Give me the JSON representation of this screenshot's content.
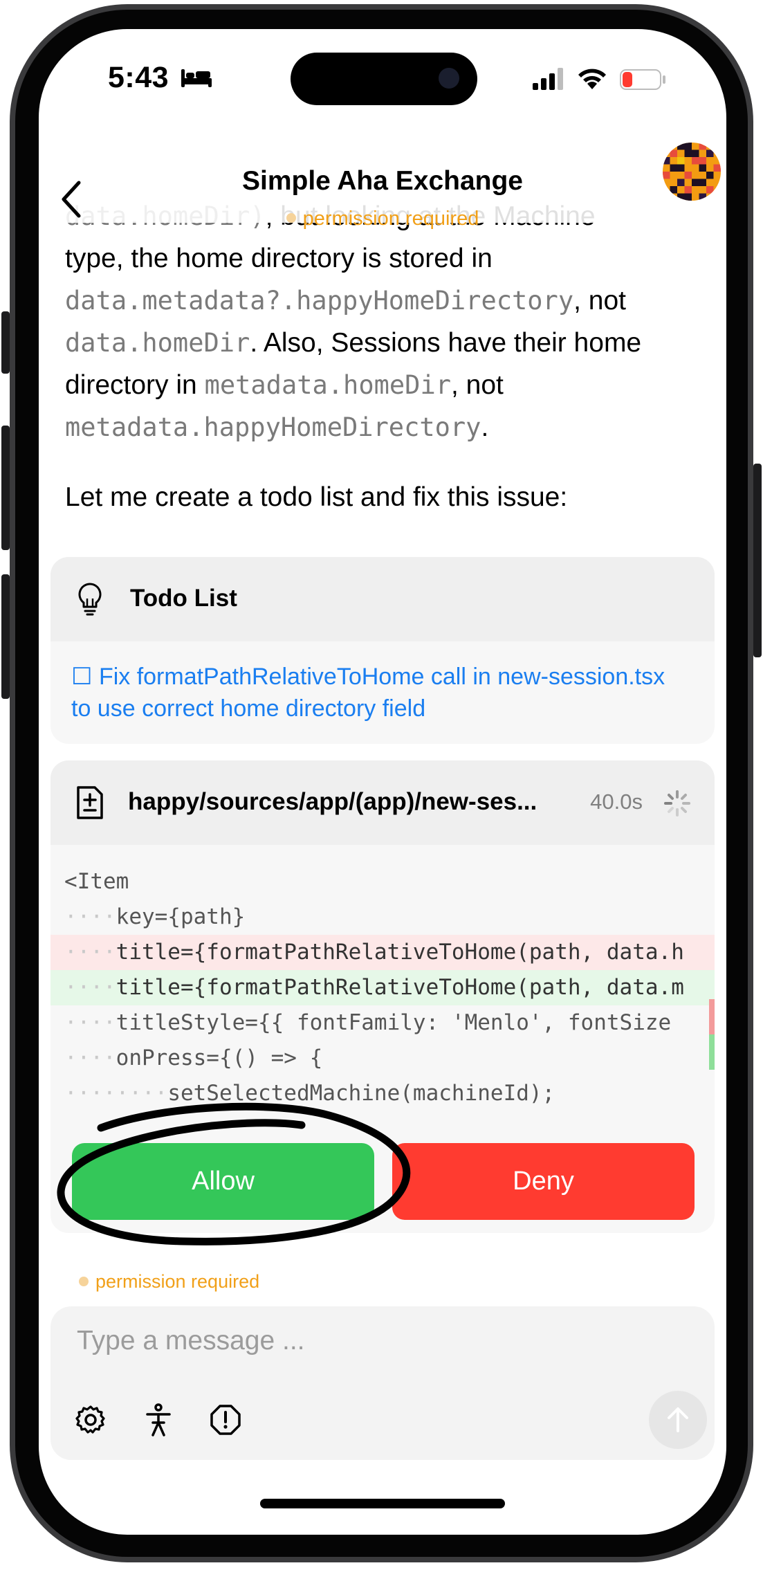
{
  "status_bar": {
    "time": "5:43",
    "battery": "13"
  },
  "header": {
    "title": "Simple Aha Exchange",
    "subtitle": "permission required"
  },
  "message": {
    "p1_line1_code": "data.homeDir)",
    "p1_line1_text": ", but looking at the Machine",
    "p1_line2": "type, the home directory is stored in",
    "p1_line3_code": "data.metadata?.happyHomeDirectory",
    "p1_line3_text": ", not",
    "p1_line4_code": "data.homeDir",
    "p1_line4_text": ". Also, Sessions have their home",
    "p1_line5_text": "directory in ",
    "p1_line5_code": "metadata.homeDir",
    "p1_line5_text2": ", not",
    "p1_line6_code": "metadata.happyHomeDirectory",
    "p1_line6_text": ".",
    "p2": "Let me create a todo list and fix this issue:"
  },
  "todo_card": {
    "title": "Todo List",
    "icon": "lightbulb-icon",
    "item_checkbox": "☐",
    "item": "Fix formatPathRelativeToHome call in new-session.tsx to use correct home directory field"
  },
  "edit_card": {
    "file": "happy/sources/app/(app)/new-ses...",
    "elapsed": "40.0s",
    "icon": "file-diff-icon",
    "code_lines": [
      {
        "indent": "",
        "text": "<Item",
        "kind": "ctx"
      },
      {
        "indent": "····",
        "text": "key={path}",
        "kind": "ctx"
      },
      {
        "indent": "····",
        "text": "title={formatPathRelativeToHome(path, data.h",
        "kind": "del"
      },
      {
        "indent": "····",
        "text": "title={formatPathRelativeToHome(path, data.m",
        "kind": "add"
      },
      {
        "indent": "····",
        "text": "titleStyle={{ fontFamily: 'Menlo', fontSize",
        "kind": "ctx"
      },
      {
        "indent": "····",
        "text": "onPress={() => {",
        "kind": "ctx"
      },
      {
        "indent": "········",
        "text": "setSelectedMachine(machineId);",
        "kind": "ctx"
      }
    ],
    "allow_label": "Allow",
    "deny_label": "Deny"
  },
  "footer_status": "permission required",
  "composer": {
    "placeholder": "Type a message ..."
  },
  "colors": {
    "accent_orange": "#f1a019",
    "allow_green": "#34c759",
    "deny_red": "#ff3b30",
    "link_blue": "#1a7ef0"
  }
}
